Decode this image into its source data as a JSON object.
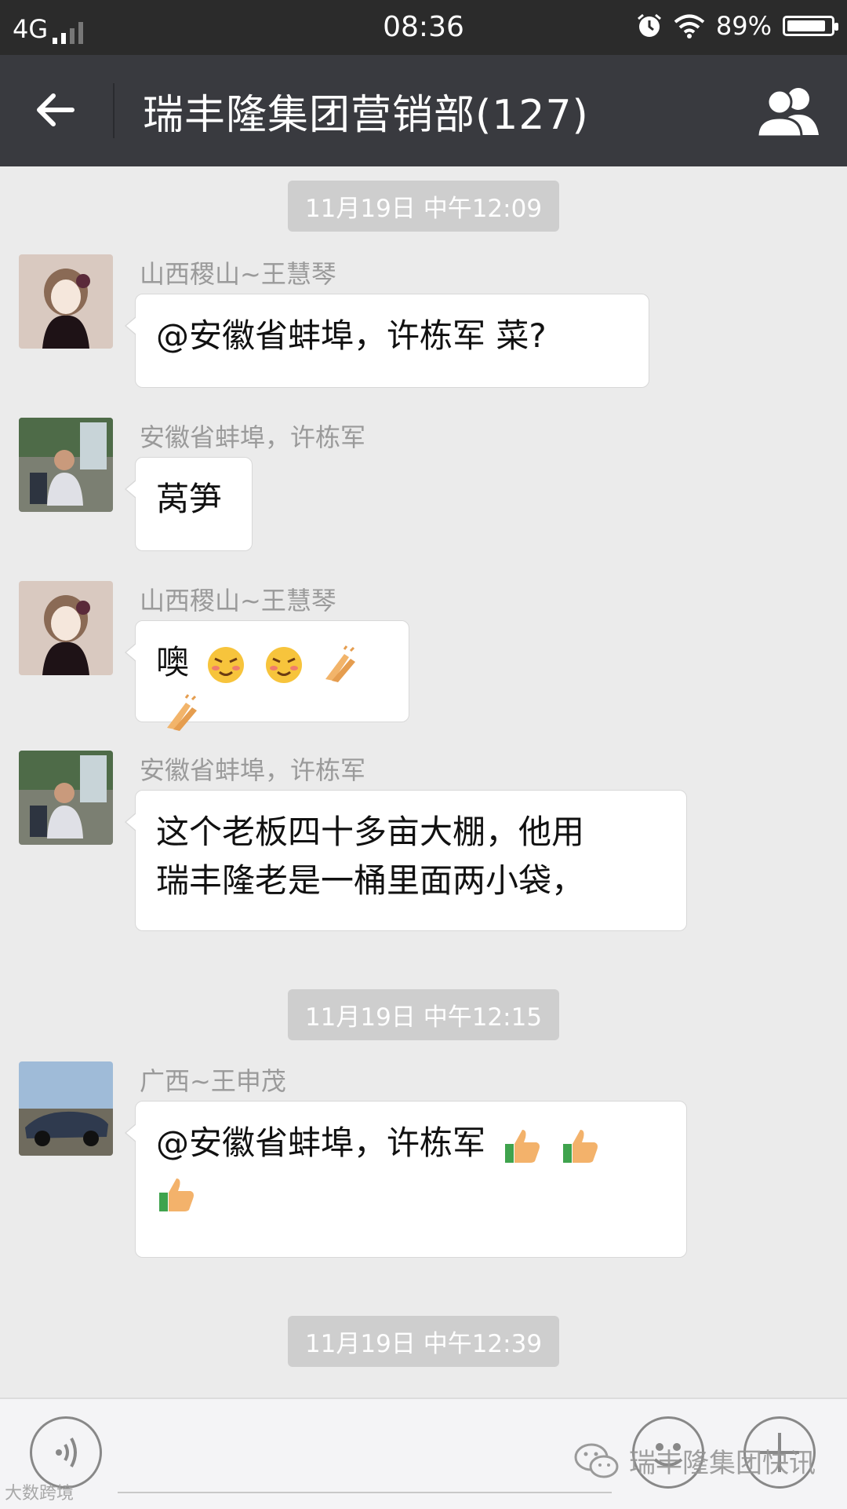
{
  "status_bar": {
    "network": "4G",
    "time": "08:36",
    "battery": "89%",
    "battery_level": 0.89
  },
  "header": {
    "title": "瑞丰隆集团营销部(127)"
  },
  "chat": {
    "timestamps": [
      "11月19日 中午12:09",
      "11月19日 中午12:15",
      "11月19日 中午12:39"
    ],
    "messages": [
      {
        "sender": "山西稷山~王慧琴",
        "text": "@安徽省蚌埠，许栋军   菜?"
      },
      {
        "sender": "安徽省蚌埠，许栋军",
        "text": "莴笋"
      },
      {
        "sender": "山西稷山~王慧琴",
        "text": "噢",
        "emojis": [
          "blush-emoji",
          "blush-emoji",
          "clap-emoji",
          "clap-emoji"
        ]
      },
      {
        "sender": "安徽省蚌埠，许栋军",
        "line1": "这个老板四十多亩大棚，他用",
        "line2": "瑞丰隆老是一桶里面两小袋，"
      },
      {
        "sender": "广西~王申茂",
        "text": "@安徽省蚌埠，许栋军",
        "emojis": [
          "thumbs-up-emoji",
          "thumbs-up-emoji",
          "thumbs-up-emoji"
        ]
      }
    ]
  },
  "watermark": {
    "text": "瑞丰隆集团快讯",
    "corner": "大数跨境"
  },
  "colors": {
    "titlebar": "#393a3f",
    "statusbar": "#2b2b2b",
    "background": "#ebebeb",
    "timestamp_bg": "#cecece"
  }
}
